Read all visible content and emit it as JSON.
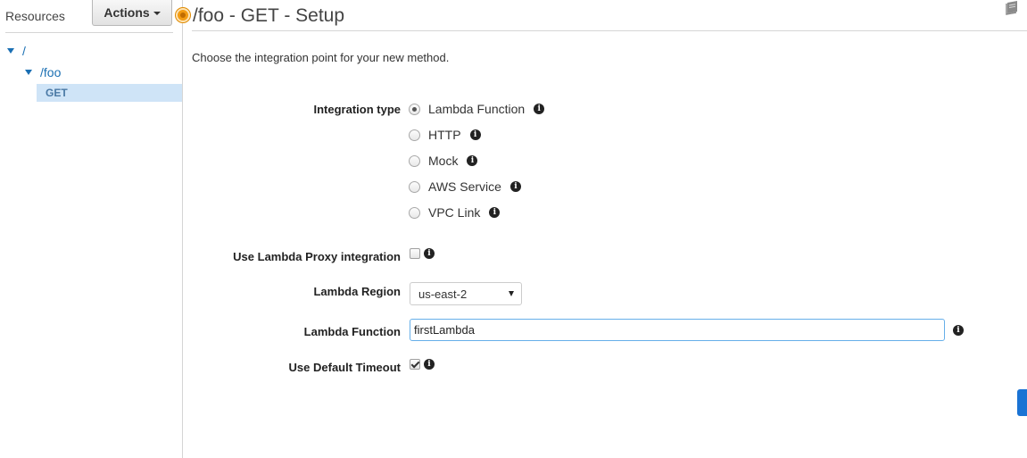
{
  "sidebar": {
    "title": "Resources",
    "actions_label": "Actions",
    "tree": {
      "root": "/",
      "foo": "/foo",
      "method": "GET"
    }
  },
  "header": {
    "title": "/foo - GET - Setup"
  },
  "main": {
    "intro": "Choose the integration point for your new method.",
    "integration_type": {
      "label": "Integration type",
      "options": [
        "Lambda Function",
        "HTTP",
        "Mock",
        "AWS Service",
        "VPC Link"
      ],
      "selected": "Lambda Function"
    },
    "proxy": {
      "label": "Use Lambda Proxy integration",
      "checked": false
    },
    "region": {
      "label": "Lambda Region",
      "value": "us-east-2"
    },
    "function": {
      "label": "Lambda Function",
      "value": "firstLambda"
    },
    "timeout": {
      "label": "Use Default Timeout",
      "checked": true
    },
    "info_glyph": "i"
  },
  "colors": {
    "link": "#1a6fb3",
    "selected_bg": "#cfe4f7",
    "status": "#f39c12",
    "primary_button": "#1a73d4",
    "focus_border": "#66afe9"
  }
}
